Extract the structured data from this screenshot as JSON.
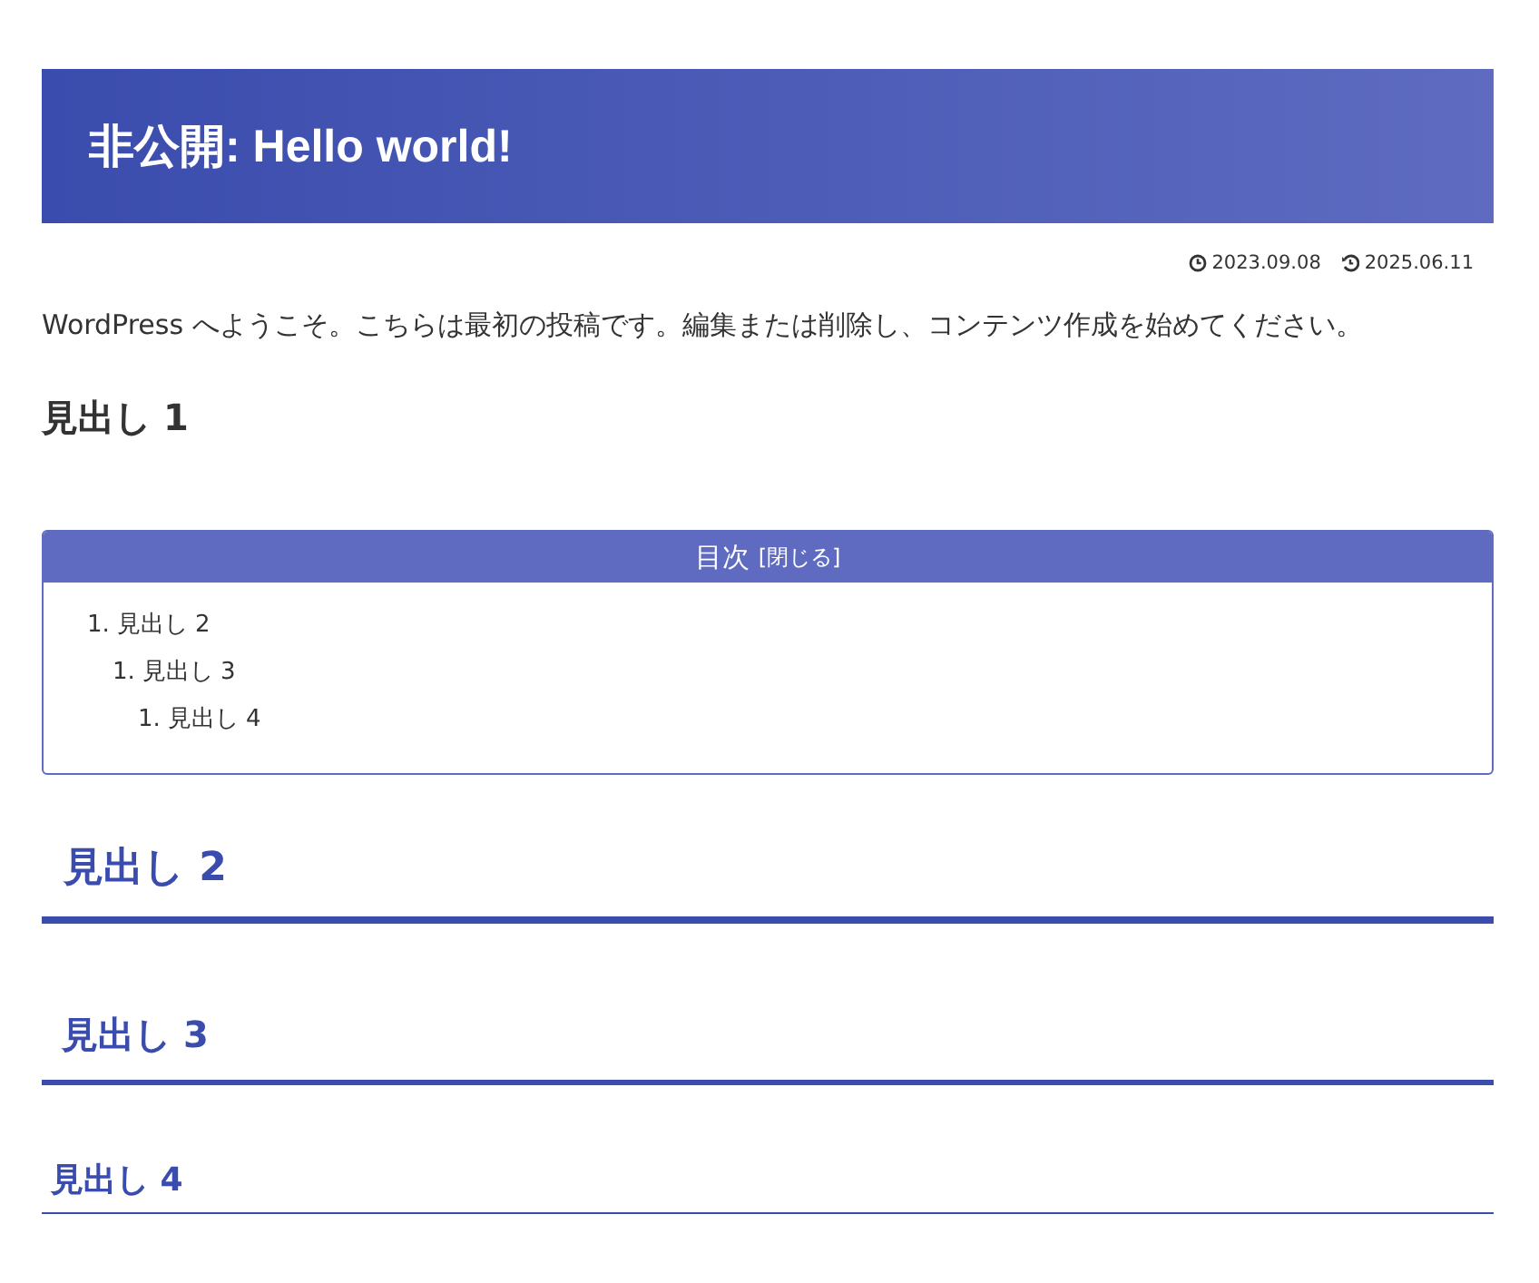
{
  "title": "非公開: Hello world!",
  "dates": {
    "published": "2023.09.08",
    "updated": "2025.06.11"
  },
  "intro": "WordPress へようこそ。こちらは最初の投稿です。編集または削除し、コンテンツ作成を始めてください。",
  "headings_before": [
    {
      "kind": "plain",
      "text": "見出し 1"
    }
  ],
  "toc": {
    "title": "目次",
    "toggle": "[閉じる]",
    "items": [
      {
        "number": "1.",
        "text": "見出し 2",
        "children": [
          {
            "number": "1.",
            "text": "見出し 3",
            "children": [
              {
                "number": "1.",
                "text": "見出し 4"
              }
            ]
          }
        ]
      }
    ]
  },
  "headings": [
    {
      "kind": "large",
      "text": "見出し 2"
    },
    {
      "kind": "medium",
      "text": "見出し 3"
    },
    {
      "kind": "small",
      "text": "見出し 4"
    }
  ]
}
